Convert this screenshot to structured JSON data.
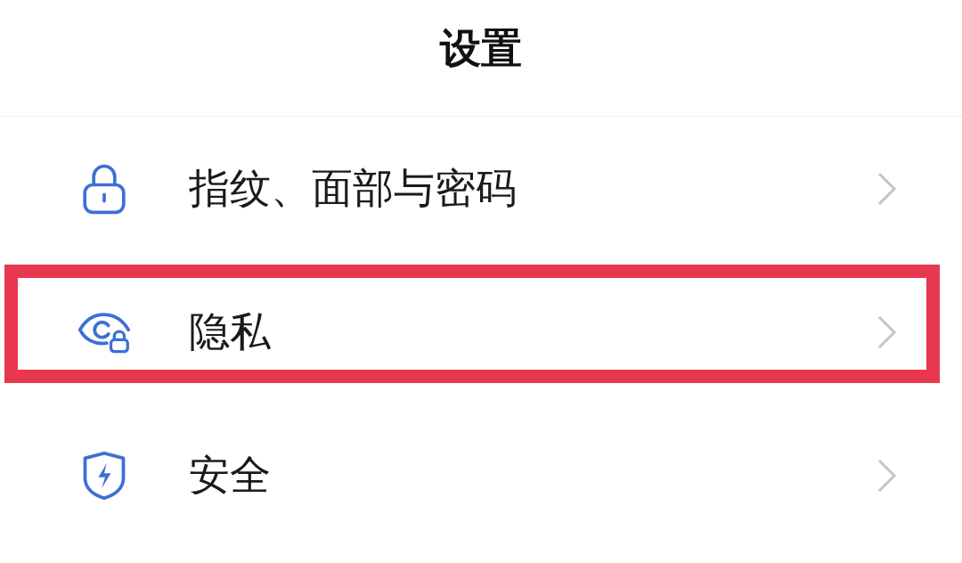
{
  "header": {
    "title": "设置"
  },
  "items": [
    {
      "kind": "lock",
      "label": "指纹、面部与密码",
      "highlighted": false
    },
    {
      "kind": "privacy",
      "label": "隐私",
      "highlighted": true
    },
    {
      "kind": "security",
      "label": "安全",
      "highlighted": false
    }
  ]
}
